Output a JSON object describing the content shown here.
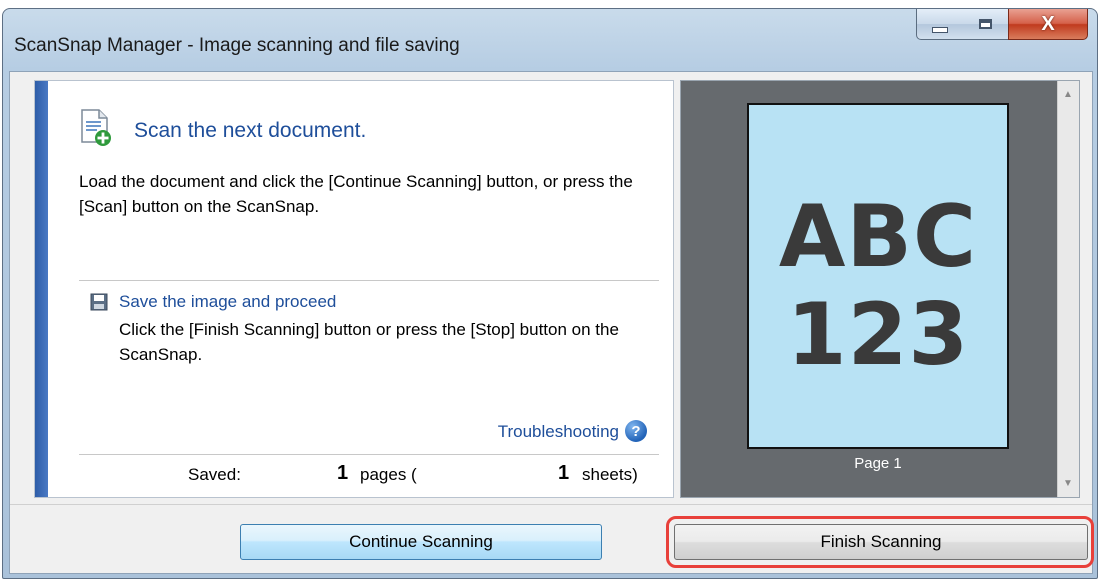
{
  "window": {
    "title": "ScanSnap Manager - Image scanning and file saving",
    "close_glyph": "X"
  },
  "left": {
    "heading": "Scan the next document.",
    "description": "Load the document and click the [Continue Scanning] button, or press the [Scan] button on the ScanSnap.",
    "save_title": "Save the image and proceed",
    "save_description": "Click the [Finish Scanning] button or press the [Stop] button on the ScanSnap.",
    "troubleshooting": "Troubleshooting",
    "help_glyph": "?",
    "saved_label": "Saved:",
    "saved_pages": "1",
    "pages_label": "pages (",
    "saved_sheets": "1",
    "sheets_label": "sheets)"
  },
  "preview": {
    "thumb_line1": "ABC",
    "thumb_line2": "123",
    "page_label": "Page 1"
  },
  "buttons": {
    "continue": "Continue Scanning",
    "finish": "Finish Scanning"
  },
  "colors": {
    "accent_blue": "#1e4e9a",
    "highlight_red": "#e8403a"
  }
}
